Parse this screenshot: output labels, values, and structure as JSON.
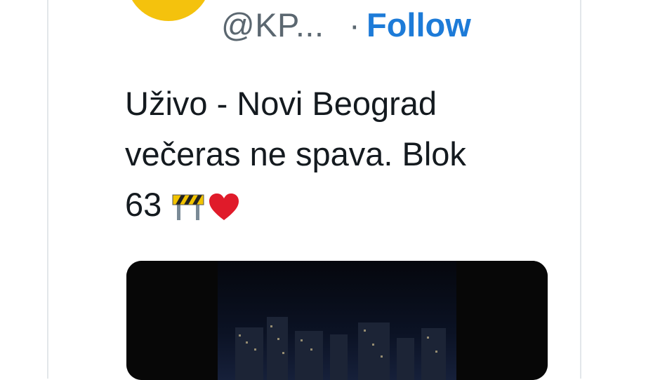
{
  "tweet": {
    "handle": "@KP...",
    "separator": "·",
    "follow_label": "Follow",
    "text_lines": [
      "Uživo - Novi Beograd",
      "večeras ne spava. Blok",
      "63"
    ],
    "emojis": [
      "construction-barrier-icon",
      "red-heart-icon"
    ]
  },
  "colors": {
    "follow": "#1d7bd8",
    "handle": "#5b6770",
    "text": "#141a1f",
    "avatar": "#f4c20d"
  }
}
